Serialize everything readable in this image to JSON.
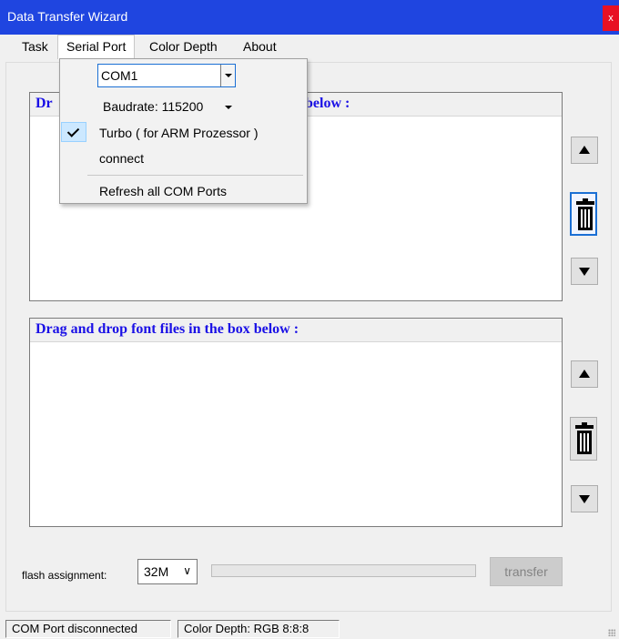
{
  "window": {
    "title": "Data Transfer Wizard",
    "close_label": "x"
  },
  "menubar": {
    "items": [
      {
        "label": "Task"
      },
      {
        "label": "Serial Port",
        "open": true
      },
      {
        "label": "Color Depth"
      },
      {
        "label": "About"
      }
    ]
  },
  "serial_menu": {
    "port_select_value": "COM1",
    "baudrate_label": "Baudrate: 115200",
    "turbo_label": "Turbo ( for ARM Prozessor )",
    "turbo_checked": true,
    "connect_label": "connect",
    "refresh_label": "Refresh all COM Ports"
  },
  "panels": {
    "top": {
      "header_left": "Dr",
      "header_right": "ox below :"
    },
    "bottom": {
      "header": "Drag and drop font files in the box below :"
    }
  },
  "footer": {
    "flash_label": "flash assignment:",
    "flash_value": "32M",
    "progress_percent": 0,
    "transfer_label": "transfer"
  },
  "status": {
    "com_port": "COM Port  disconnected",
    "color_depth": "Color Depth:  RGB 8:8:8"
  },
  "colors": {
    "title_bar": "#1f45e0",
    "panel_header_text": "#1a10e6",
    "close": "#e81123"
  }
}
